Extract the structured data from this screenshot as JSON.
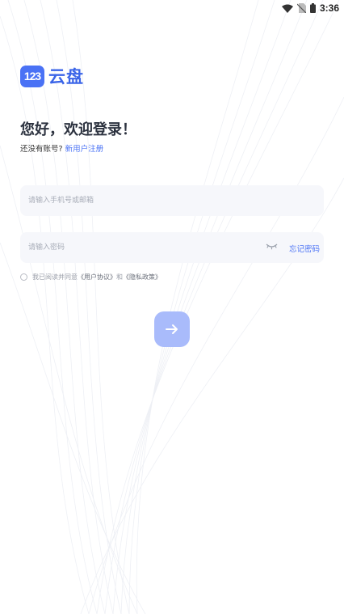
{
  "status_bar": {
    "time": "3:36",
    "icons": [
      "wifi-icon",
      "no-sim-icon",
      "battery-icon"
    ]
  },
  "logo": {
    "badge_text": "123",
    "app_name": "云盘"
  },
  "welcome": {
    "title": "您好，欢迎登录！",
    "no_account_text": "还没有账号?",
    "signup_link": "新用户注册"
  },
  "form": {
    "phone_placeholder": "请输入手机号或邮箱",
    "phone_value": "",
    "password_placeholder": "请输入密码",
    "password_value": "",
    "forgot_password": "忘记密码",
    "password_toggle_icon": "eye-closed-icon"
  },
  "agreement": {
    "checked": false,
    "prefix": "我已阅读并同意",
    "user_agreement": "《用户协议》",
    "and": "和",
    "privacy_policy": "《隐私政策》"
  },
  "login_button": {
    "icon": "arrow-right-icon"
  },
  "colors": {
    "accent": "#4a72f5",
    "button_disabled": "#a9bbfb",
    "input_bg": "#f6f7fb",
    "title_text": "#2d3340"
  }
}
